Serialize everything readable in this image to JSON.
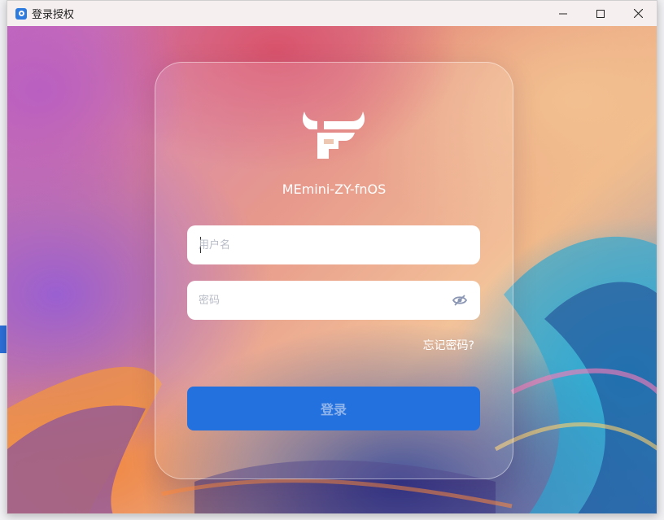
{
  "window": {
    "title": "登录授权",
    "controls": [
      "minimize-icon",
      "maximize-icon",
      "close-icon"
    ]
  },
  "login": {
    "brand": "MEmini-ZY-fnOS",
    "username_placeholder": "用户名",
    "username_value": "",
    "password_placeholder": "密码",
    "password_value": "",
    "password_toggle_icon": "eye-slash-icon",
    "forgot_label": "忘记密码?",
    "submit_label": "登录"
  },
  "colors": {
    "accent": "#2370df",
    "submit_text": "#8fb4ea",
    "card_border": "rgba(255,255,255,0.45)"
  }
}
